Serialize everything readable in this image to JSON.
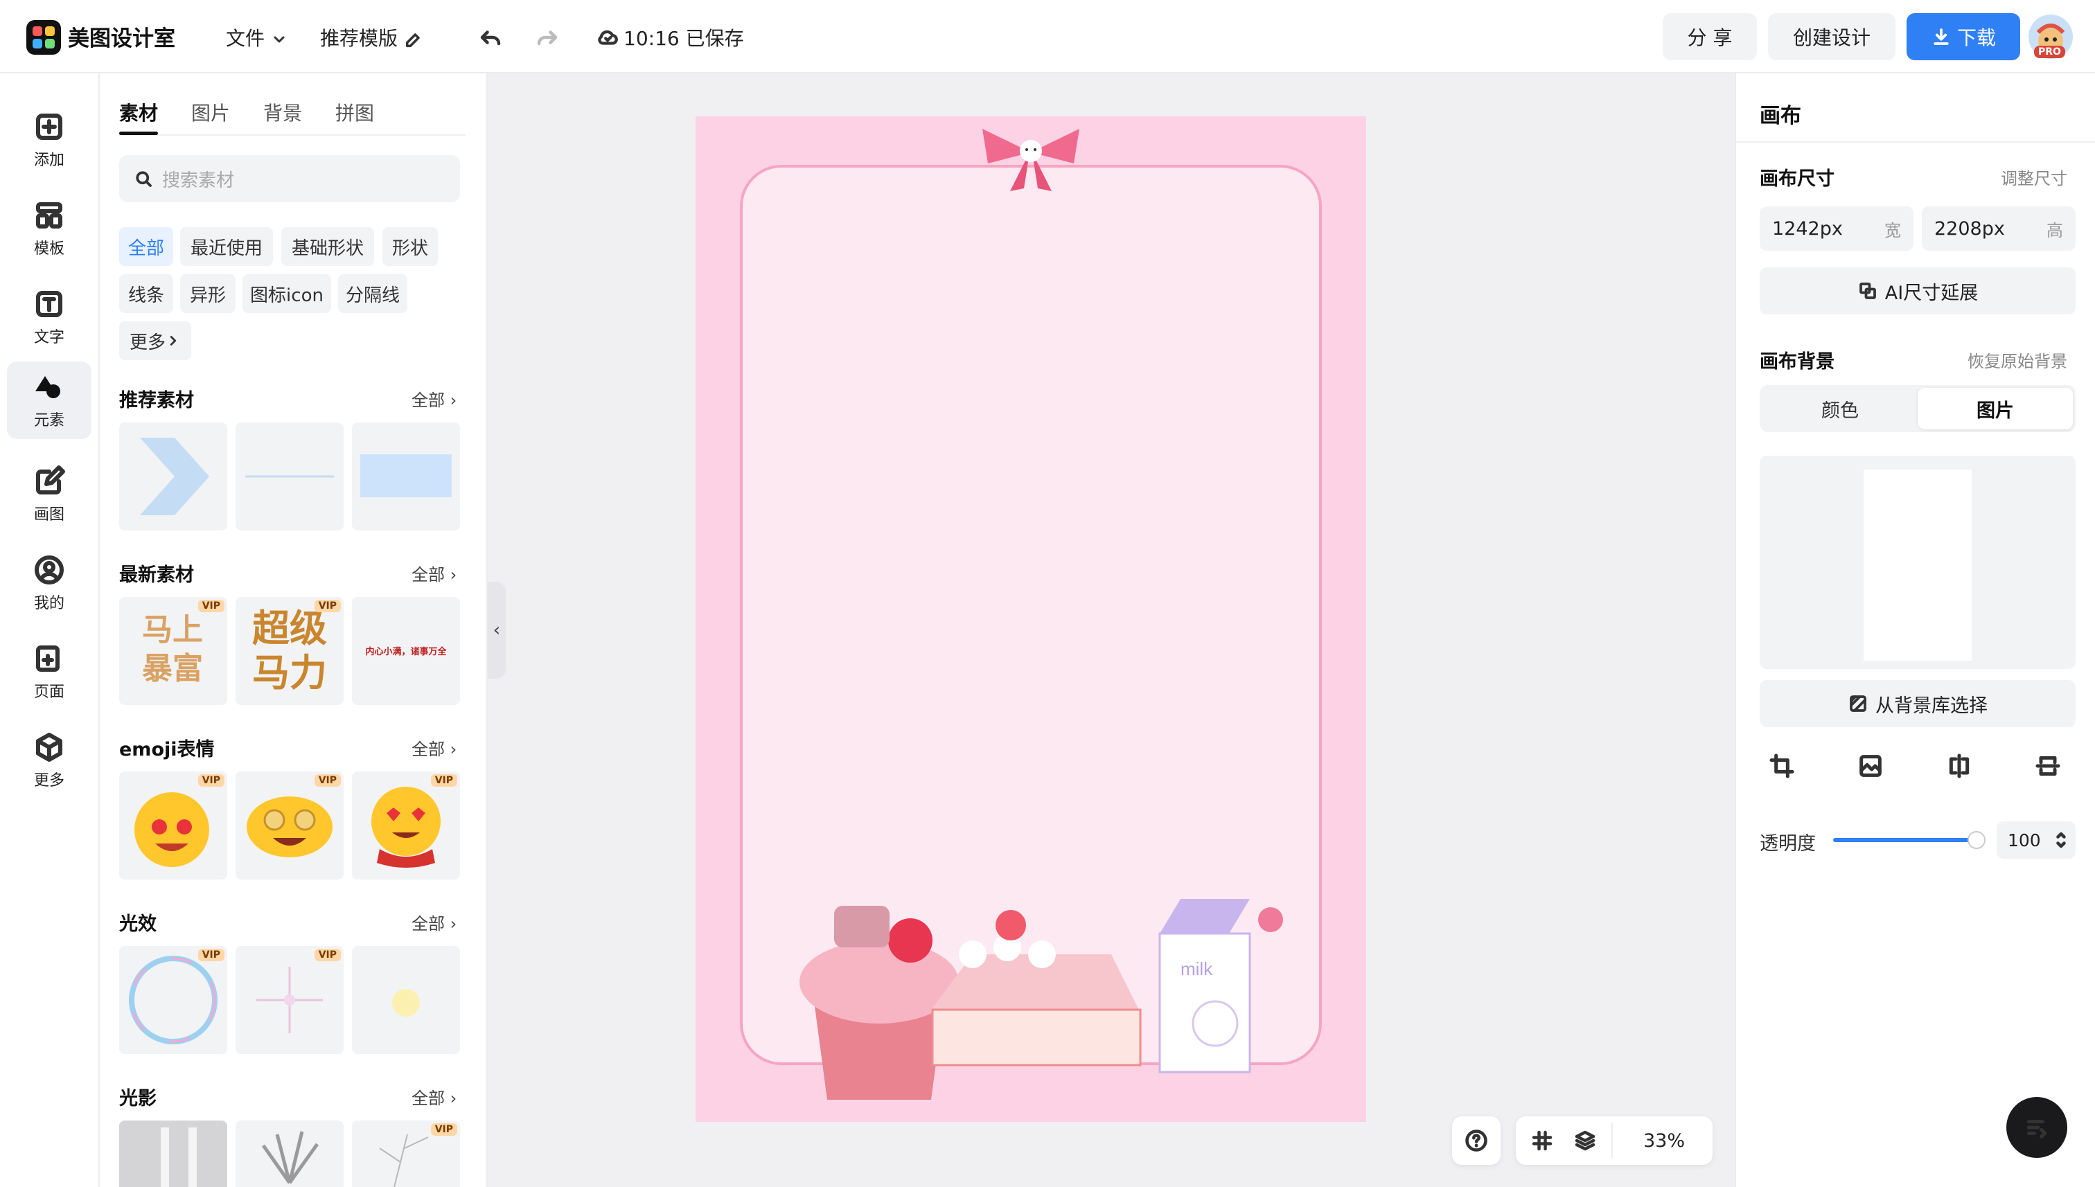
{
  "app": {
    "name": "美图设计室"
  },
  "topbar": {
    "file_menu": "文件",
    "recommend_template": "推荐模版",
    "save_status": "10:16 已保存",
    "share": "分 享",
    "create_design": "创建设计",
    "download": "下载",
    "pro_badge": "PRO"
  },
  "rail": {
    "items": [
      {
        "label": "添加"
      },
      {
        "label": "模板"
      },
      {
        "label": "文字"
      },
      {
        "label": "元素"
      },
      {
        "label": "画图"
      },
      {
        "label": "我的"
      },
      {
        "label": "页面"
      },
      {
        "label": "更多"
      }
    ]
  },
  "panel": {
    "tabs": [
      "素材",
      "图片",
      "背景",
      "拼图"
    ],
    "search_placeholder": "搜索素材",
    "chips": [
      "全部",
      "最近使用",
      "基础形状",
      "形状",
      "线条",
      "异形",
      "图标icon",
      "分隔线",
      "更多"
    ],
    "sections": [
      {
        "title": "推荐素材",
        "all": "全部"
      },
      {
        "title": "最新素材",
        "all": "全部"
      },
      {
        "title": "emoji表情",
        "all": "全部"
      },
      {
        "title": "光效",
        "all": "全部"
      },
      {
        "title": "光影",
        "all": "全部"
      }
    ],
    "vip_label": "VIP",
    "sticker_texts": [
      "马上暴富",
      "超级马力",
      "内心小满，诸事万全"
    ]
  },
  "canvas": {
    "bottom_art": "milk"
  },
  "zoombar": {
    "zoom": "33%"
  },
  "right_panel": {
    "title": "画布",
    "size_label": "画布尺寸",
    "resize_link": "调整尺寸",
    "width_value": "1242px",
    "width_unit": "宽",
    "height_value": "2208px",
    "height_unit": "高",
    "ai_extend": "AI尺寸延展",
    "bg_label": "画布背景",
    "restore_bg": "恢复原始背景",
    "seg_color": "颜色",
    "seg_image": "图片",
    "from_library": "从背景库选择",
    "opacity_label": "透明度",
    "opacity_value": "100",
    "opacity_level": 1.0
  }
}
